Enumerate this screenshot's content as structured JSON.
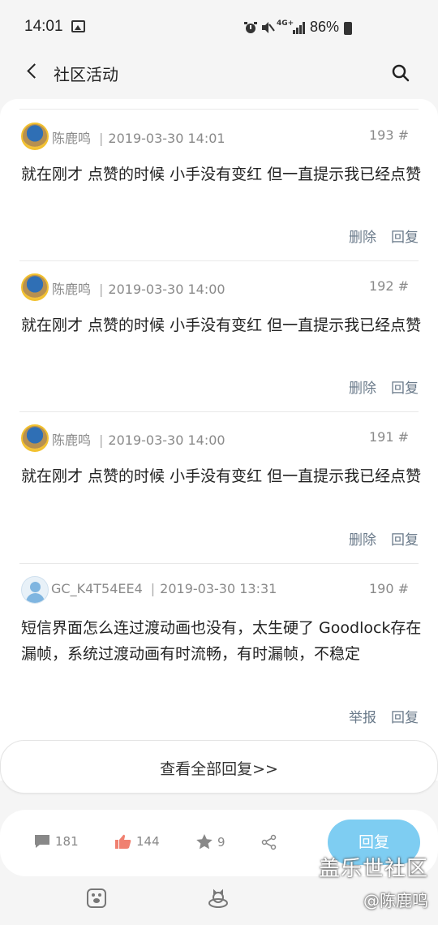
{
  "status_bar": {
    "time": "14:01",
    "battery": "86%",
    "network": "4G+"
  },
  "header": {
    "title": "社区活动"
  },
  "comments": [
    {
      "user": "陈鹿鸣",
      "datetime": "2019-03-30 14:01",
      "floor": "193 #",
      "text": "就在刚才 点赞的时候 小手没有变红 但一直提示我已经点赞",
      "actions": [
        "删除",
        "回复"
      ]
    },
    {
      "user": "陈鹿鸣",
      "datetime": "2019-03-30 14:00",
      "floor": "192 #",
      "text": "就在刚才 点赞的时候 小手没有变红 但一直提示我已经点赞",
      "actions": [
        "删除",
        "回复"
      ]
    },
    {
      "user": "陈鹿鸣",
      "datetime": "2019-03-30 14:00",
      "floor": "191 #",
      "text": "就在刚才 点赞的时候 小手没有变红 但一直提示我已经点赞",
      "actions": [
        "删除",
        "回复"
      ]
    },
    {
      "user": "GC_K4T54EE4",
      "datetime": "2019-03-30 13:31",
      "floor": "190 #",
      "text": "短信界面怎么连过渡动画也没有，太生硬了 Goodlock存在漏帧，系统过渡动画有时流畅，有时漏帧，不稳定",
      "actions": [
        "举报",
        "回复"
      ]
    }
  ],
  "view_all": "查看全部回复>>",
  "bottom_bar": {
    "comments": "181",
    "likes": "144",
    "stars": "9",
    "reply_button": "回复"
  },
  "watermark": {
    "title": "盖乐世社区",
    "user": "@陈鹿鸣"
  },
  "colors": {
    "accent": "#7ecdf2",
    "like": "#f08070",
    "action_text": "#6a7a8a"
  }
}
